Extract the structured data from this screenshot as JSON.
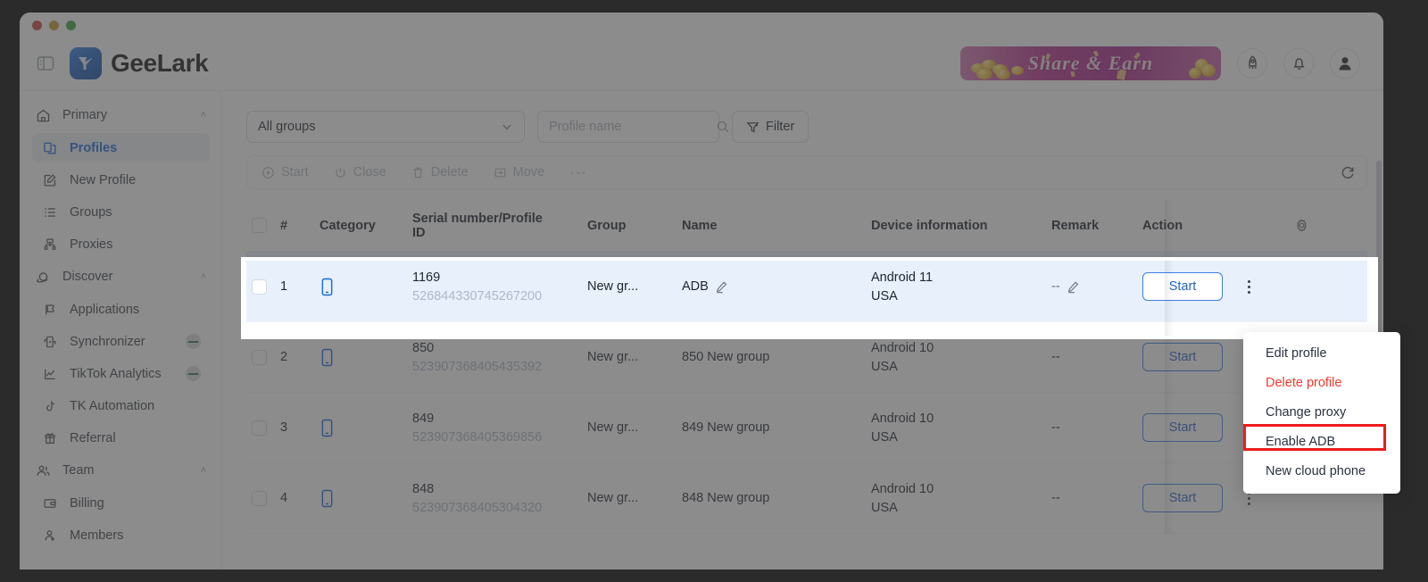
{
  "app": {
    "title": "GeeLark",
    "window_controls": [
      "close",
      "minimize",
      "maximize"
    ]
  },
  "header": {
    "panel_toggle_icon": "sidebar-panel-icon",
    "logo_icon": "geelark-logo-icon",
    "brand": "GeeLark",
    "promo_banner": {
      "text": "Share & Earn",
      "bg_color": "#b8318f"
    },
    "icons": [
      {
        "name": "rocket-icon",
        "label": "rocket"
      },
      {
        "name": "bell-icon",
        "label": "notifications"
      },
      {
        "name": "user-avatar-icon",
        "label": "account"
      }
    ]
  },
  "sidebar": {
    "groups": [
      {
        "label": "Primary",
        "icon": "home-icon",
        "chevron": "˄",
        "items": [
          {
            "label": "Profiles",
            "icon": "profiles-icon",
            "active": true,
            "badge": false
          },
          {
            "label": "New Profile",
            "icon": "new-profile-icon",
            "active": false,
            "badge": false
          },
          {
            "label": "Groups",
            "icon": "groups-list-icon",
            "active": false,
            "badge": false
          },
          {
            "label": "Proxies",
            "icon": "proxies-network-icon",
            "active": false,
            "badge": false
          }
        ]
      },
      {
        "label": "Discover",
        "icon": "discover-planet-icon",
        "chevron": "˄",
        "items": [
          {
            "label": "Applications",
            "icon": "applications-icon",
            "active": false,
            "badge": false
          },
          {
            "label": "Synchronizer",
            "icon": "synchronizer-icon",
            "active": false,
            "badge": true
          },
          {
            "label": "TikTok Analytics",
            "icon": "analytics-chart-icon",
            "active": false,
            "badge": true
          },
          {
            "label": "TK Automation",
            "icon": "tiktok-note-icon",
            "active": false,
            "badge": false
          },
          {
            "label": "Referral",
            "icon": "gift-icon",
            "active": false,
            "badge": false
          }
        ]
      },
      {
        "label": "Team",
        "icon": "team-people-icon",
        "chevron": "˄",
        "items": [
          {
            "label": "Billing",
            "icon": "billing-card-icon",
            "active": false,
            "badge": false
          },
          {
            "label": "Members",
            "icon": "member-person-icon",
            "active": false,
            "badge": false
          }
        ]
      }
    ]
  },
  "filters": {
    "group_select_value": "All groups",
    "group_select_chevron": "⌄",
    "search_placeholder": "Profile name",
    "search_value": "",
    "search_icon": "search-icon",
    "filter_button_label": "Filter",
    "filter_icon": "filter-funnel-icon"
  },
  "action_bar": {
    "items": [
      {
        "label": "Start",
        "icon": "play-circle-icon"
      },
      {
        "label": "Close",
        "icon": "power-icon"
      },
      {
        "label": "Delete",
        "icon": "trash-icon"
      },
      {
        "label": "Move",
        "icon": "move-folder-icon"
      }
    ],
    "more_label": "···",
    "refresh_icon": "refresh-icon"
  },
  "table": {
    "columns": [
      "#",
      "Category",
      "Serial number/Profile ID",
      "Group",
      "Name",
      "Device information",
      "Remark",
      "Action"
    ],
    "header_serial_line1": "Serial number/Profile",
    "header_serial_line2": "ID",
    "settings_icon": "gear-icon",
    "rows": [
      {
        "index": "1",
        "category_icon": "phone-icon",
        "serial": "1169",
        "profile_id": "526844330745267200",
        "group": "New gr...",
        "name": "ADB",
        "name_editable": true,
        "device_os": "Android 11",
        "device_region": "USA",
        "remark": "--",
        "remark_editable": true,
        "action_label": "Start",
        "highlighted": true
      },
      {
        "index": "2",
        "category_icon": "phone-icon",
        "serial": "850",
        "profile_id": "523907368405435392",
        "group": "New gr...",
        "name": "850 New group",
        "name_editable": false,
        "device_os": "Android 10",
        "device_region": "USA",
        "remark": "--",
        "remark_editable": false,
        "action_label": "Start",
        "highlighted": false
      },
      {
        "index": "3",
        "category_icon": "phone-icon",
        "serial": "849",
        "profile_id": "523907368405369856",
        "group": "New gr...",
        "name": "849 New group",
        "name_editable": false,
        "device_os": "Android 10",
        "device_region": "USA",
        "remark": "--",
        "remark_editable": false,
        "action_label": "Start",
        "highlighted": false
      },
      {
        "index": "4",
        "category_icon": "phone-icon",
        "serial": "848",
        "profile_id": "523907368405304320",
        "group": "New gr...",
        "name": "848 New group",
        "name_editable": false,
        "device_os": "Android 10",
        "device_region": "USA",
        "remark": "--",
        "remark_editable": false,
        "action_label": "Start",
        "highlighted": false
      }
    ]
  },
  "context_menu": {
    "items": [
      {
        "label": "Edit profile",
        "danger": false,
        "highlighted": false
      },
      {
        "label": "Delete profile",
        "danger": true,
        "highlighted": false
      },
      {
        "label": "Change proxy",
        "danger": false,
        "highlighted": false
      },
      {
        "label": "Enable ADB",
        "danger": false,
        "highlighted": true
      },
      {
        "label": "New cloud phone",
        "danger": false,
        "highlighted": false
      }
    ],
    "highlight_color": "#ee1c1c"
  }
}
